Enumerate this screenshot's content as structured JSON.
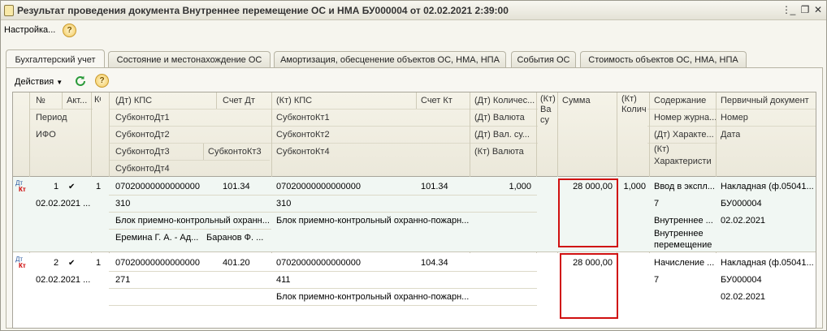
{
  "window": {
    "title": "Результат проведения документа Внутреннее перемещение ОС и НМА БУ000004 от 02.02.2021 2:39:00"
  },
  "menu": {
    "settings_label": "Настройка...",
    "help": "?"
  },
  "tabs": [
    "Бухгалтерский учет",
    "Состояние и местонахождение ОС",
    "Амортизация, обесценение объектов ОС, НМА, НПА",
    "События ОС",
    "Стоимость объектов ОС, НМА, НПА"
  ],
  "toolbar": {
    "actions_label": "Действия",
    "help": "?"
  },
  "headers": {
    "num": "№",
    "active": "Акт...",
    "kfo": "КФО",
    "period": "Период",
    "ifo": "ИФО",
    "dt_kps": "(Дт) КПС",
    "schet_dt": "Счет Дт",
    "subkonto_dt1": "СубконтоДт1",
    "subkonto_dt2": "СубконтоДт2",
    "subkonto_dt3": "СубконтоДт3",
    "subkonto_kt3": "СубконтоКт3",
    "subkonto_dt4": "СубконтоДт4",
    "kt_kps": "(Кт) КПС",
    "schet_kt": "Счет Кт",
    "subkonto_kt1": "СубконтоКт1",
    "subkonto_kt2": "СубконтоКт2",
    "subkonto_kt4": "СубконтоКт4",
    "dt_qty": "(Дт) Количес...",
    "dt_currency": "(Дт) Валюта",
    "dt_cur_amount": "(Дт) Вал. су...",
    "kt_currency": "(Кт) Валюта",
    "kt_va_su": "(Кт) Ва су",
    "summa": "Сумма",
    "kt_qty": "(Кт) Колич",
    "content": "Содержание",
    "journal_no": "Номер журна...",
    "dt_char": "(Дт) Характе...",
    "kt_char": "(Кт) Характеристи",
    "primary_doc": "Первичный документ",
    "number": "Номер",
    "date": "Дата"
  },
  "rows": [
    {
      "dt": "Дт",
      "kt": "Кт",
      "num": "1",
      "active": "✔",
      "kfo": "1",
      "period": "02.02.2021 ...",
      "dt_kps": "07020000000000000",
      "schet_dt": "101.34",
      "subkonto_dt1": "310",
      "subkonto_dt2": "Блок приемно-контрольный охранн...",
      "subkonto_dt3": "Еремина Г. А. - Ад...",
      "subkonto_kt3": "Баранов Ф. ...",
      "kt_kps": "07020000000000000",
      "schet_kt": "101.34",
      "subkonto_kt1": "310",
      "subkonto_kt2": "Блок приемно-контрольный охранно-пожарн...",
      "dt_qty": "1,000",
      "summa": "28 000,00",
      "kt_qty": "1,000",
      "content": "Ввод в экспл...",
      "journal_no": "7",
      "dt_char": "Внутреннее ...",
      "kt_char_1": "Внутреннее",
      "kt_char_2": "перемещение",
      "primary_doc": "Накладная (ф.05041...",
      "number": "БУ000004",
      "date": "02.02.2021"
    },
    {
      "dt": "Дт",
      "kt": "Кт",
      "num": "2",
      "active": "✔",
      "kfo": "1",
      "period": "02.02.2021 ...",
      "dt_kps": "07020000000000000",
      "schet_dt": "401.20",
      "subkonto_dt1": "271",
      "kt_kps": "07020000000000000",
      "schet_kt": "104.34",
      "subkonto_kt1": "411",
      "subkonto_kt3": "Блок приемно-контрольный охранно-пожарн...",
      "summa": "28 000,00",
      "content": "Начисление ...",
      "journal_no": "7",
      "primary_doc": "Накладная (ф.05041...",
      "number": "БУ000004",
      "date": "02.02.2021"
    }
  ]
}
